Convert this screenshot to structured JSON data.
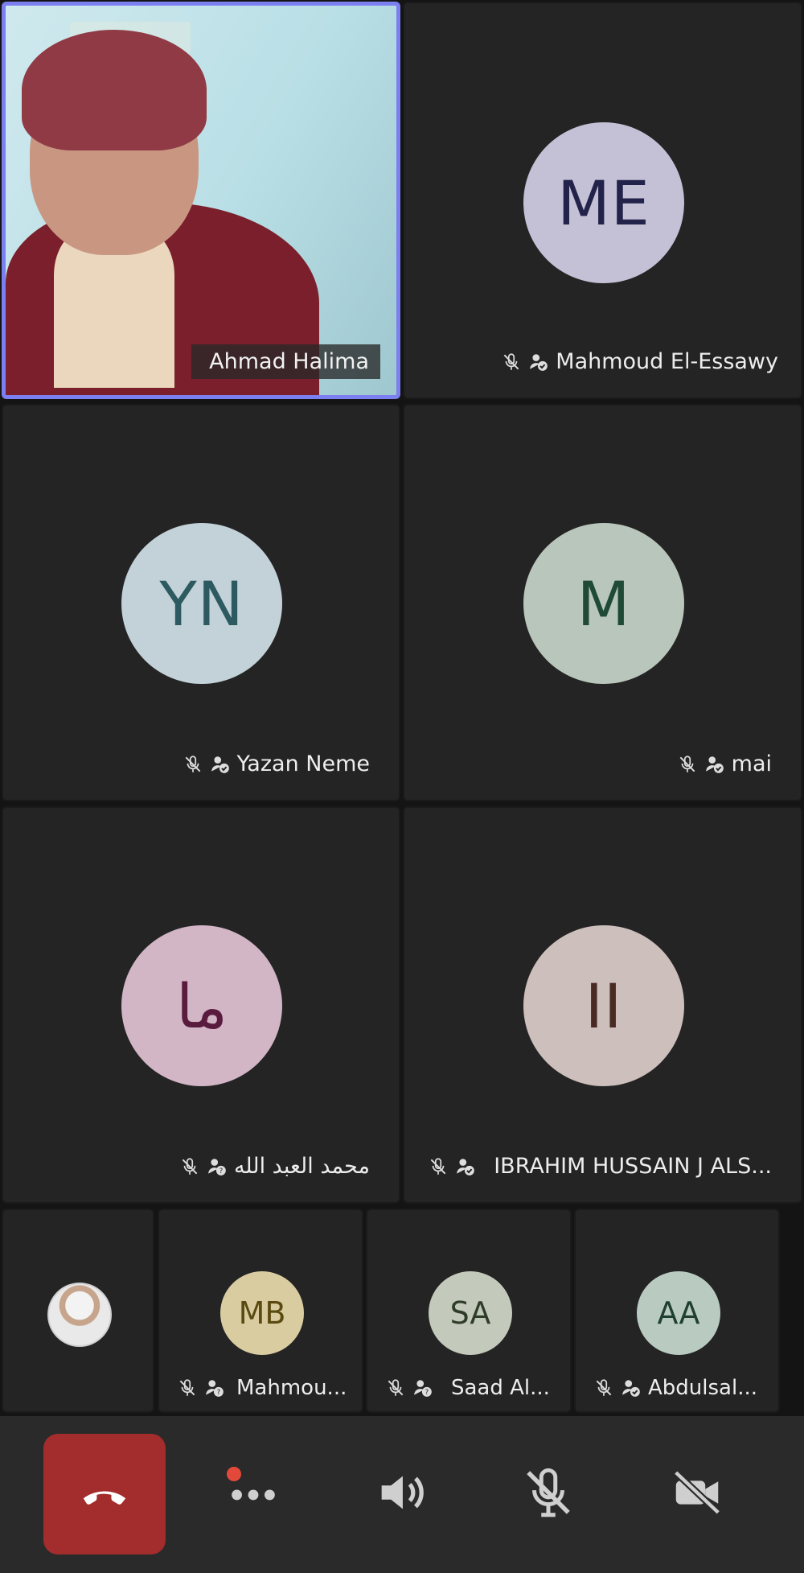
{
  "tiles_large": [
    {
      "kind": "video",
      "name": "Ahmad Halima",
      "active": true
    },
    {
      "kind": "avatar",
      "initials": "ME",
      "name": "Mahmoud El-Essawy",
      "muted": true,
      "avatar_bg": "#c4c1d7",
      "initials_color": "#22224a"
    },
    {
      "kind": "avatar",
      "initials": "YN",
      "name": "Yazan Neme",
      "muted": true,
      "avatar_bg": "#c3d2d9",
      "initials_color": "#2d5a60"
    },
    {
      "kind": "avatar",
      "initials": "M",
      "name": "mai",
      "muted": true,
      "avatar_bg": "#b9c6bb",
      "initials_color": "#1f4a35"
    },
    {
      "kind": "avatar",
      "initials": "ما",
      "name": "محمد العبد الله",
      "muted": true,
      "avatar_bg": "#d2b6c6",
      "initials_color": "#5a1c3e"
    },
    {
      "kind": "avatar",
      "initials": "II",
      "name": "IBRAHIM HUSSAIN J ALS...",
      "muted": true,
      "avatar_bg": "#cdbfbc",
      "initials_color": "#4a2a24"
    }
  ],
  "tiles_small": [
    {
      "kind": "photo",
      "name": ""
    },
    {
      "kind": "avatar",
      "initials": "MB",
      "name": "Mahmou...",
      "muted": true,
      "avatar_bg": "#dacca1",
      "initials_color": "#5a4a10"
    },
    {
      "kind": "avatar",
      "initials": "SA",
      "name": "Saad Al...",
      "muted": true,
      "avatar_bg": "#c3c9bb",
      "initials_color": "#2f3d28"
    },
    {
      "kind": "avatar",
      "initials": "AA",
      "name": "Abdulsal...",
      "muted": true,
      "avatar_bg": "#b9cbc0",
      "initials_color": "#1f3f30"
    }
  ],
  "controls": {
    "end_call": "end-call",
    "more": "more-options",
    "speaker": "speaker",
    "mic": "mic-off",
    "camera": "camera-off"
  },
  "colors": {
    "active_border": "#7b7ff0",
    "end_call": "#a32c2c",
    "recording_dot": "#e2493b"
  }
}
